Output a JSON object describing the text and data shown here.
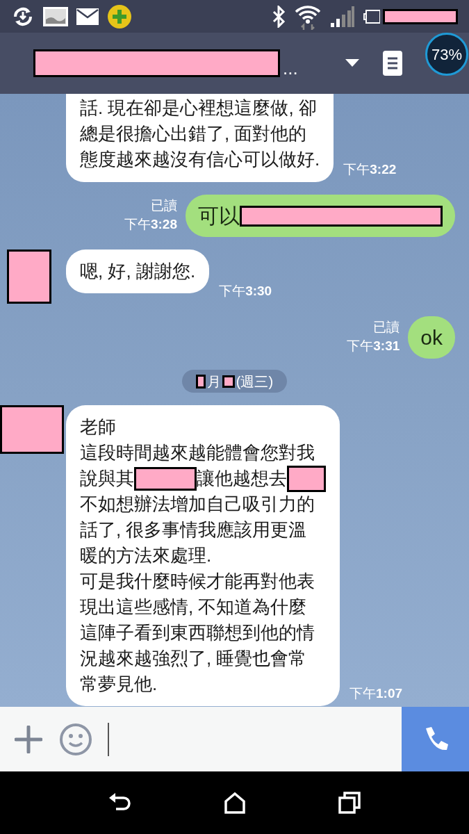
{
  "header": {
    "title": [
      {
        "kind": "redaction"
      },
      {
        "kind": "text",
        "text": "..."
      }
    ]
  },
  "memory_widget": {
    "text": "73%"
  },
  "messages": [
    {
      "kind": "received",
      "avatar_shown": false,
      "body": [
        {
          "kind": "text",
          "lines": [
            "話. 現在卻是心裡想這麼做, 卻",
            "總是很擔心出錯了, 面對他的",
            "態度越來越沒有信心可以做好."
          ]
        }
      ],
      "time": "下午**3:22**"
    },
    {
      "kind": "sent",
      "read": "已讀",
      "body": [
        {
          "kind": "line",
          "segments": [
            {
              "kind": "text",
              "text": "可以"
            },
            {
              "kind": "redaction"
            }
          ]
        }
      ],
      "time": "下午**3:28**"
    },
    {
      "kind": "received",
      "avatar_shown": true,
      "body": [
        {
          "kind": "text",
          "lines": [
            "嗯, 好, 謝謝您."
          ]
        }
      ],
      "time": "下午**3:30**"
    },
    {
      "kind": "sent",
      "read": "已讀",
      "body": [
        {
          "kind": "text",
          "lines": [
            "ok"
          ]
        }
      ],
      "time": "下午**3:31**"
    },
    {
      "kind": "date",
      "segments": [
        {
          "kind": "redaction"
        },
        {
          "kind": "text",
          "text": "月"
        },
        {
          "kind": "redaction"
        },
        {
          "kind": "text",
          "text": "(週三)"
        }
      ]
    },
    {
      "kind": "received",
      "avatar_shown": true,
      "body": [
        {
          "kind": "text",
          "lines": [
            "老師",
            "這段時間越來越能體會您對我"
          ]
        },
        {
          "kind": "line",
          "segments": [
            {
              "kind": "text",
              "text": "說與其"
            },
            {
              "kind": "redaction"
            },
            {
              "kind": "text",
              "text": "讓他越想去"
            },
            {
              "kind": "redaction"
            }
          ]
        },
        {
          "kind": "text",
          "lines": [
            "不如想辦法增加自己吸引力的",
            "話了, 很多事情我應該用更溫",
            "暖的方法來處理.",
            "可是我什麼時候才能再對他表",
            "現出這些感情, 不知道為什麼",
            "這陣子看到東西聯想到他的情",
            "況越來越強烈了, 睡覺也會常",
            "常夢見他."
          ]
        }
      ],
      "time": "下午**1:07**"
    }
  ]
}
